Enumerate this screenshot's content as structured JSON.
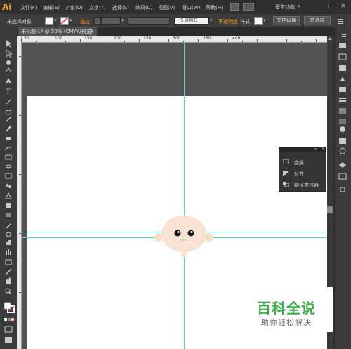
{
  "app": {
    "logo": "Ai"
  },
  "menu": [
    "文件(F)",
    "编辑(E)",
    "对象(O)",
    "文字(T)",
    "选择(S)",
    "效果(C)",
    "视图(V)",
    "窗口(W)",
    "帮助(H)"
  ],
  "workspace": "基本功能",
  "window_controls": {
    "minimize": "–",
    "restore": "□",
    "close": "✕"
  },
  "control_bar": {
    "selection_status": "未选择对象",
    "stroke_label": "描边",
    "brush_value": "5 点圆形",
    "opacity_label": "不透明度",
    "style_label": "样式",
    "doc_setup_button": "文档设置",
    "preferences_button": "首选项",
    "colors": {
      "fill": "#ffffff",
      "stroke_label": "#f7a321"
    }
  },
  "document_tab": {
    "title": "未标题-1* @ 50% (CMYK/预览)",
    "close": "×"
  },
  "ruler": {
    "labels": [
      "50",
      "100",
      "150",
      "200",
      "250",
      "300",
      "350",
      "400"
    ]
  },
  "panel": {
    "items": [
      {
        "label": "变换",
        "icon": "transform-icon"
      },
      {
        "label": "对齐",
        "icon": "align-icon"
      },
      {
        "label": "路径查找器",
        "icon": "pathfinder-icon"
      }
    ]
  },
  "artwork": {
    "face_color": "#f7dcc8",
    "eye_color": "#1a1a1a"
  },
  "watermark": {
    "title": "百科全说",
    "subtitle": "助你轻松解决",
    "color": "#3bb24a"
  }
}
